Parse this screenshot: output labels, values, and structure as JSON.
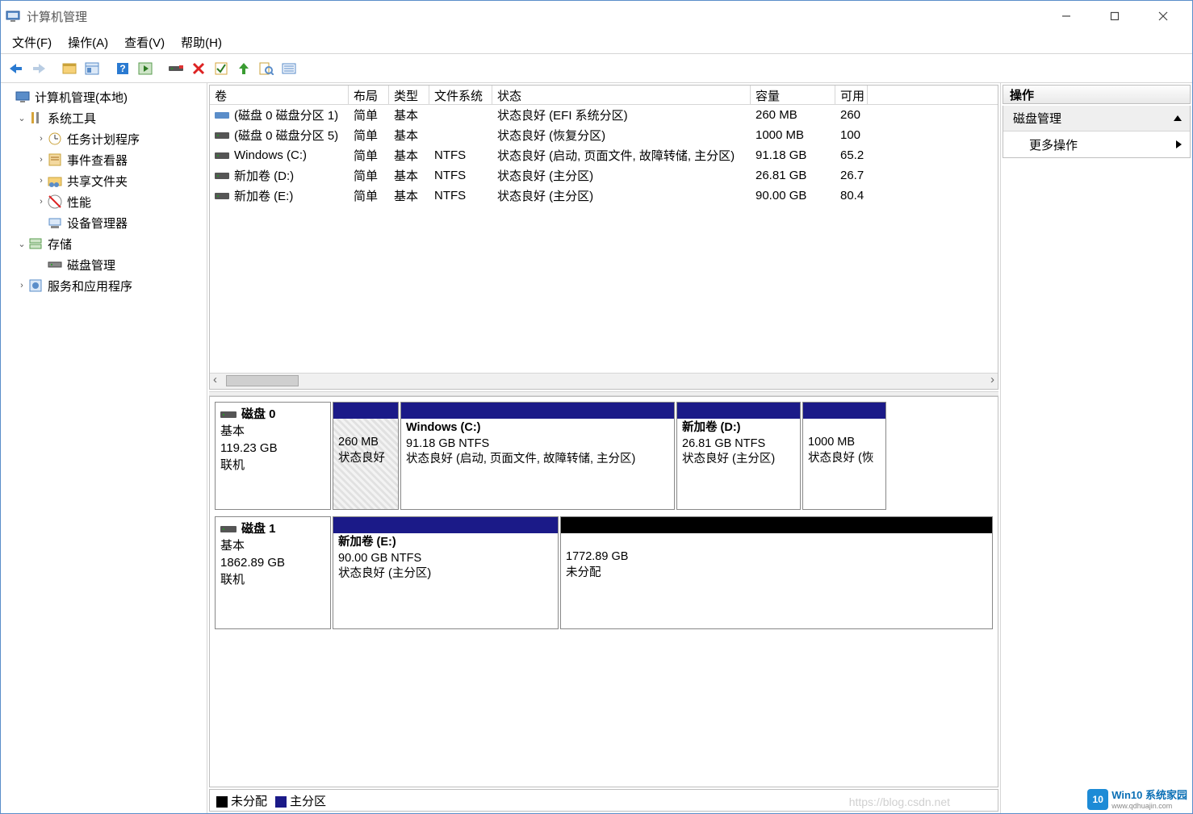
{
  "window": {
    "title": "计算机管理"
  },
  "menu": {
    "file": "文件(F)",
    "action": "操作(A)",
    "view": "查看(V)",
    "help": "帮助(H)"
  },
  "tree": {
    "root": "计算机管理(本地)",
    "sys_tools": "系统工具",
    "task_sched": "任务计划程序",
    "event_viewer": "事件查看器",
    "shared_folders": "共享文件夹",
    "performance": "性能",
    "device_mgr": "设备管理器",
    "storage": "存储",
    "disk_mgmt": "磁盘管理",
    "svc_apps": "服务和应用程序"
  },
  "vol_headers": {
    "volume": "卷",
    "layout": "布局",
    "type": "类型",
    "fs": "文件系统",
    "status": "状态",
    "capacity": "容量",
    "avail": "可用"
  },
  "volumes": [
    {
      "name": "(磁盘 0 磁盘分区 1)",
      "layout": "简单",
      "type": "基本",
      "fs": "",
      "status": "状态良好 (EFI 系统分区)",
      "capacity": "260 MB",
      "avail": "260"
    },
    {
      "name": "(磁盘 0 磁盘分区 5)",
      "layout": "简单",
      "type": "基本",
      "fs": "",
      "status": "状态良好 (恢复分区)",
      "capacity": "1000 MB",
      "avail": "100"
    },
    {
      "name": "Windows (C:)",
      "layout": "简单",
      "type": "基本",
      "fs": "NTFS",
      "status": "状态良好 (启动, 页面文件, 故障转储, 主分区)",
      "capacity": "91.18 GB",
      "avail": "65.2"
    },
    {
      "name": "新加卷 (D:)",
      "layout": "简单",
      "type": "基本",
      "fs": "NTFS",
      "status": "状态良好 (主分区)",
      "capacity": "26.81 GB",
      "avail": "26.7"
    },
    {
      "name": "新加卷 (E:)",
      "layout": "简单",
      "type": "基本",
      "fs": "NTFS",
      "status": "状态良好 (主分区)",
      "capacity": "90.00 GB",
      "avail": "80.4"
    }
  ],
  "disks": {
    "d0": {
      "title": "磁盘 0",
      "type": "基本",
      "size": "119.23 GB",
      "state": "联机"
    },
    "d1": {
      "title": "磁盘 1",
      "type": "基本",
      "size": "1862.89 GB",
      "state": "联机"
    }
  },
  "parts": {
    "d0p1": {
      "size": "260 MB",
      "status_short": "状态良好"
    },
    "d0p2": {
      "title": "Windows  (C:)",
      "line2": "91.18 GB NTFS",
      "status": "状态良好 (启动, 页面文件, 故障转储, 主分区)"
    },
    "d0p3": {
      "title": "新加卷  (D:)",
      "line2": "26.81 GB NTFS",
      "status": "状态良好 (主分区)"
    },
    "d0p4": {
      "size": "1000 MB",
      "status_short": "状态良好 (恢"
    },
    "d1p1": {
      "title": "新加卷  (E:)",
      "line2": "90.00 GB NTFS",
      "status": "状态良好 (主分区)"
    },
    "d1p2": {
      "size": "1772.89 GB",
      "status": "未分配"
    }
  },
  "legend": {
    "unallocated": "未分配",
    "primary": "主分区"
  },
  "actions": {
    "header": "操作",
    "disk_mgmt": "磁盘管理",
    "more": "更多操作"
  },
  "watermark": {
    "url": "https://blog.csdn.net",
    "brand": "Win10 系统家园",
    "site": "www.qdhuajin.com",
    "logo": "10"
  }
}
